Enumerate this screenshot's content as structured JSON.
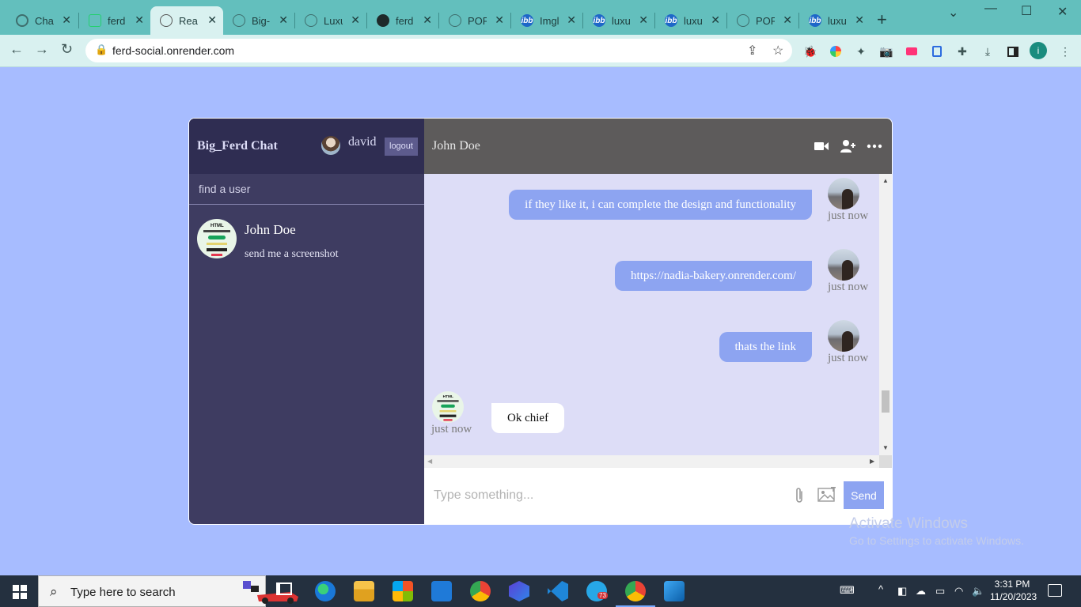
{
  "browser": {
    "tabs": [
      {
        "label": "Chat"
      },
      {
        "label": "ferd"
      },
      {
        "label": "Reac",
        "active": true
      },
      {
        "label": "Big-"
      },
      {
        "label": "Luxu"
      },
      {
        "label": "ferd"
      },
      {
        "label": "POR"
      },
      {
        "label": "Imgl"
      },
      {
        "label": "luxu"
      },
      {
        "label": "luxu"
      },
      {
        "label": "POR"
      },
      {
        "label": "luxu"
      }
    ],
    "url": "ferd-social.onrender.com",
    "profile_initial": "i"
  },
  "sidebar": {
    "brand": "Big_Ferd Chat",
    "user_name": "david",
    "logout_label": "logout",
    "search_placeholder": "find a user",
    "chats": [
      {
        "name": "John Doe",
        "last_message": "send me a screenshot",
        "avatar_text": "HTML"
      }
    ]
  },
  "chat": {
    "title": "John Doe",
    "messages": [
      {
        "text": "if they like it, i can complete the design and functionality",
        "owner": true,
        "time": "just now"
      },
      {
        "text": "https://nadia-bakery.onrender.com/",
        "owner": true,
        "time": "just now"
      },
      {
        "text": "thats the link",
        "owner": true,
        "time": "just now"
      },
      {
        "text": "Ok chief",
        "owner": false,
        "time": "just now",
        "avatar_text": "HTML"
      }
    ],
    "input_placeholder": "Type something...",
    "send_label": "Send"
  },
  "watermark": {
    "line1": "Activate Windows",
    "line2": "Go to Settings to activate Windows."
  },
  "taskbar": {
    "search_placeholder": "Type here to search",
    "telegram_badge": "73",
    "time": "3:31 PM",
    "date": "11/20/2023"
  },
  "colors": {
    "page_bg": "#a7bcff",
    "sidebar_bg": "#3e3c61",
    "sidebar_header_bg": "#2f2d52",
    "chat_header_bg": "#5d5b5b",
    "messages_bg": "#ddddf7",
    "owner_bubble": "#8da4f1",
    "browser_frame": "#63bfbd"
  }
}
